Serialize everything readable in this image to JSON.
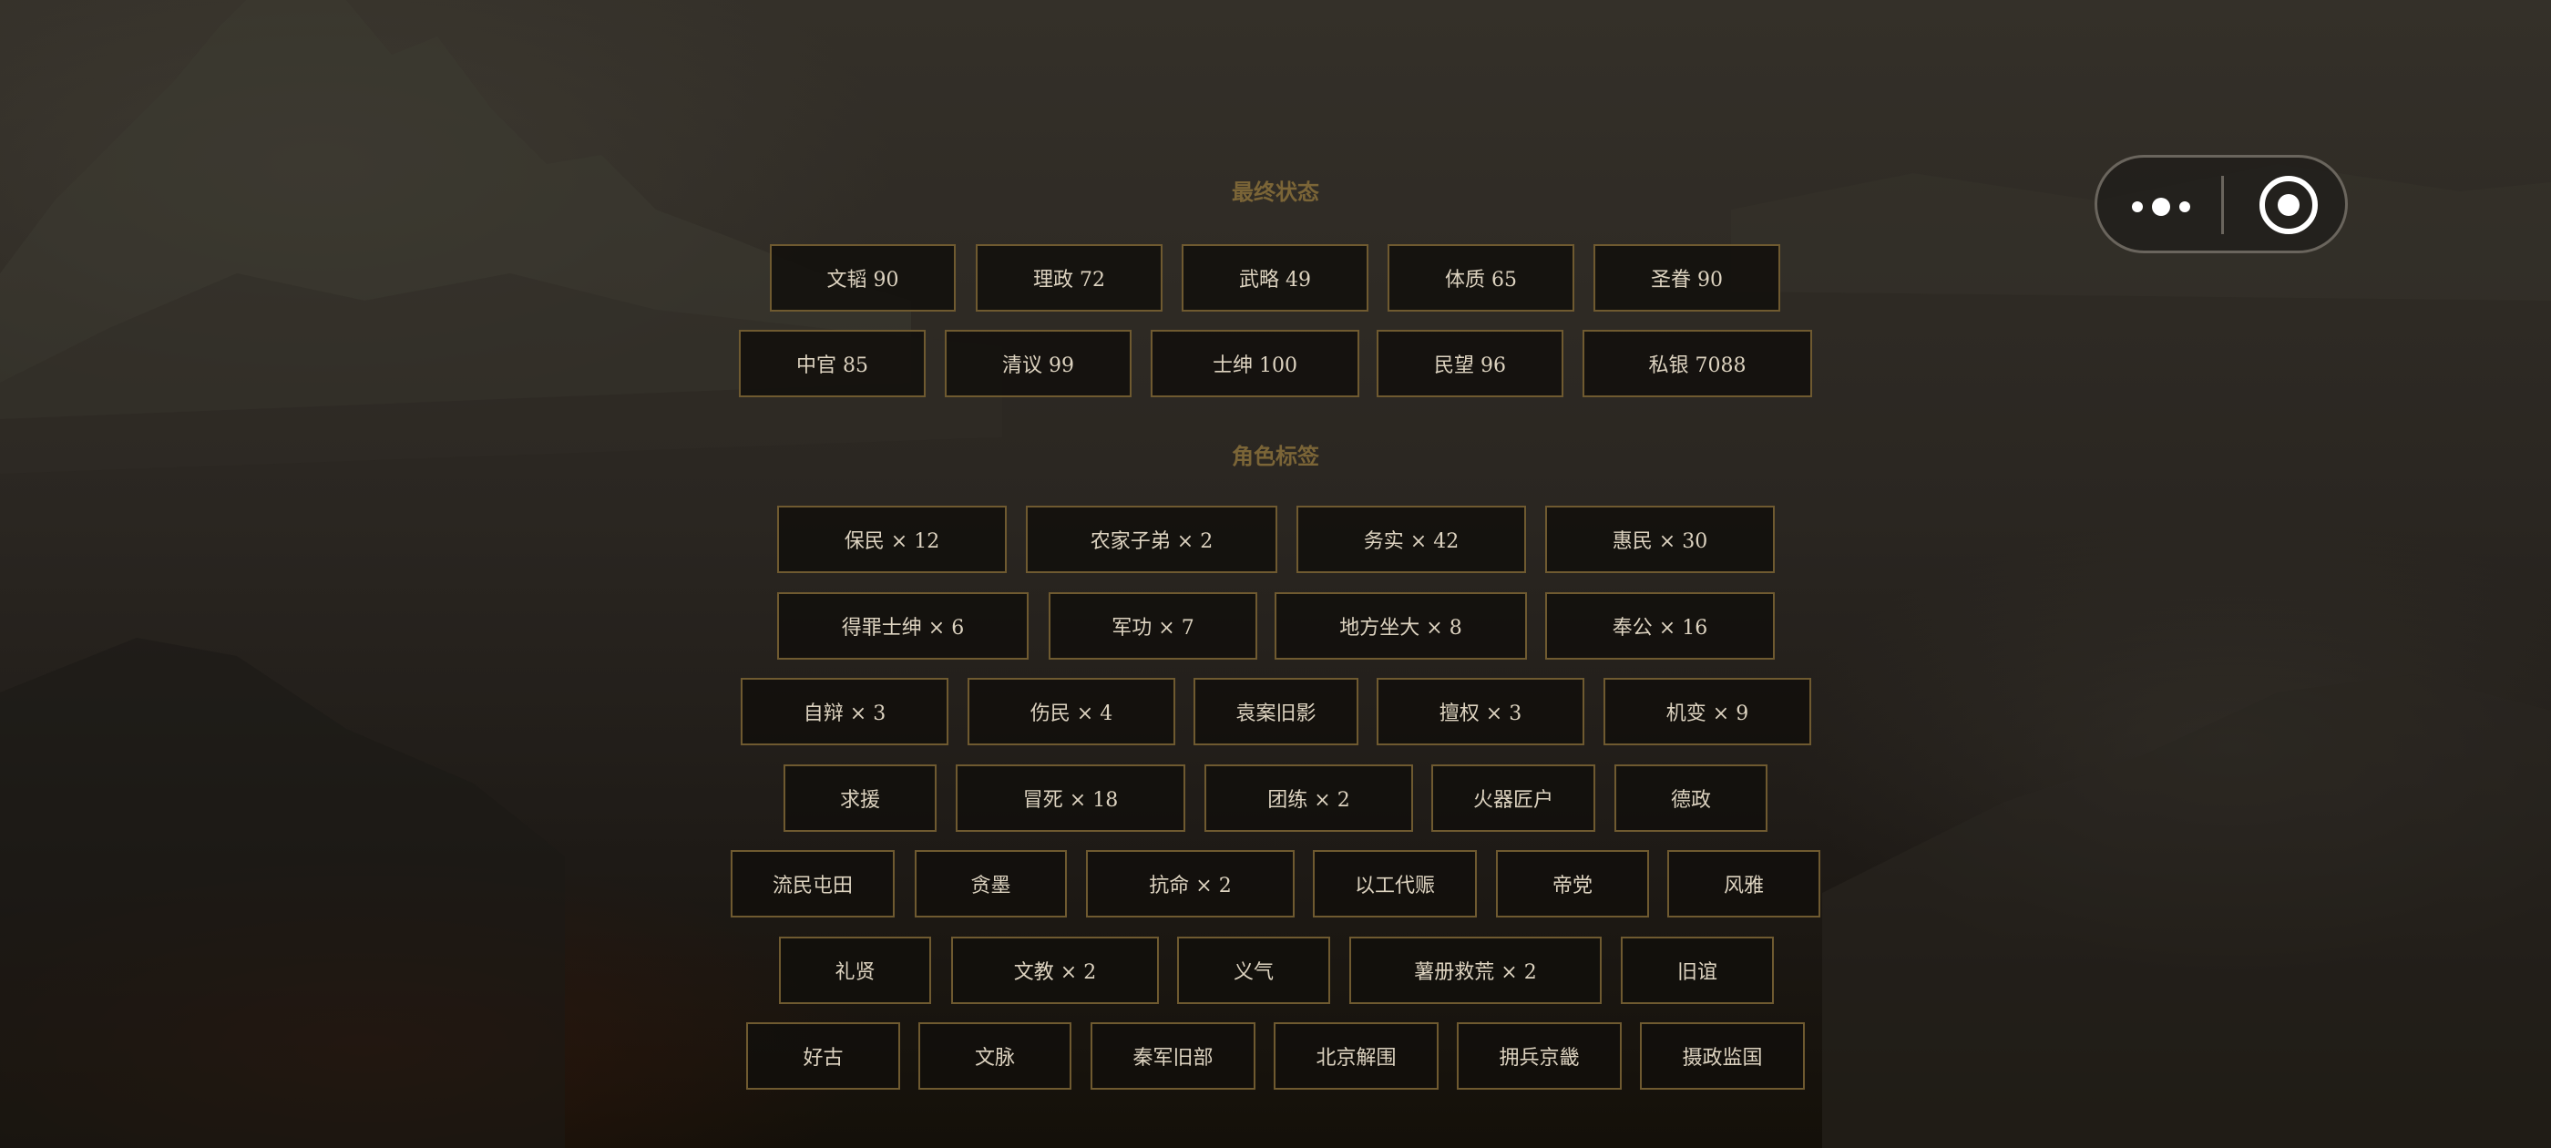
{
  "colors": {
    "accent": "#7b6537",
    "chip_border": "#6f5a30",
    "chip_text": "#ddd3c0"
  },
  "capsule": {
    "more_icon": "more-dots-icon",
    "target_icon": "record-circle-icon"
  },
  "final_status": {
    "title": "最终状态",
    "rows": [
      [
        "文韬 90",
        "理政 72",
        "武略 49",
        "体质 65",
        "圣眷 90"
      ],
      [
        "中官 85",
        "清议 99",
        "士绅 100",
        "民望 96",
        "私银 7088"
      ]
    ]
  },
  "role_tags": {
    "title": "角色标签",
    "rows": [
      [
        "保民 × 12",
        "农家子弟 × 2",
        "务实 × 42",
        "惠民 × 30"
      ],
      [
        "得罪士绅 × 6",
        "军功 × 7",
        "地方坐大 × 8",
        "奉公 × 16"
      ],
      [
        "自辩 × 3",
        "伤民 × 4",
        "袁案旧影",
        "擅权 × 3",
        "机变 × 9"
      ],
      [
        "求援",
        "冒死 × 18",
        "团练 × 2",
        "火器匠户",
        "德政"
      ],
      [
        "流民屯田",
        "贪墨",
        "抗命 × 2",
        "以工代赈",
        "帝党",
        "风雅"
      ],
      [
        "礼贤",
        "文教 × 2",
        "义气",
        "薯册救荒 × 2",
        "旧谊"
      ],
      [
        "好古",
        "文脉",
        "秦军旧部",
        "北京解围",
        "拥兵京畿",
        "摄政监国"
      ]
    ]
  }
}
